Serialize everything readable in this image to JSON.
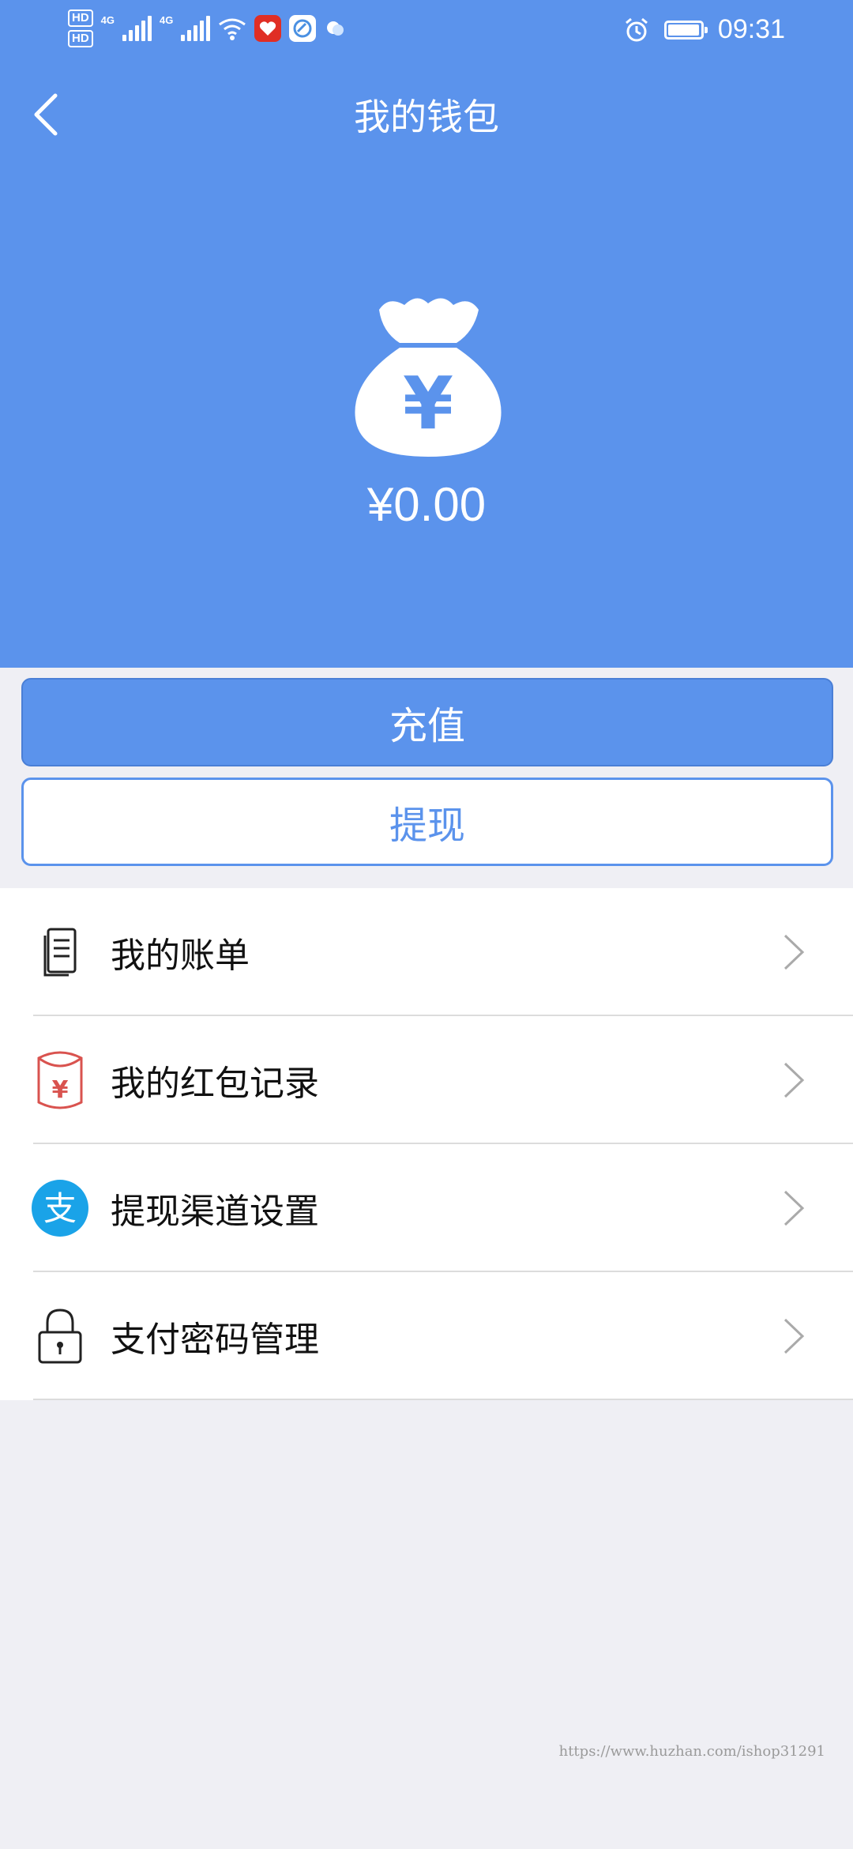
{
  "status_bar": {
    "hd_1": "HD",
    "hd_2": "HD",
    "net_1": "4G",
    "net_2": "4G",
    "time": "09:31",
    "icons": [
      "signal-icon",
      "wifi-icon",
      "alarm-icon",
      "battery-icon"
    ]
  },
  "header": {
    "title": "我的钱包",
    "back_icon": "chevron-left-icon"
  },
  "wallet": {
    "balance": "¥0.00",
    "icon": "money-bag-icon",
    "bag_symbol": "¥"
  },
  "actions": {
    "recharge_label": "充值",
    "withdraw_label": "提现"
  },
  "menu": {
    "items": [
      {
        "label": "我的账单",
        "icon": "bill-icon"
      },
      {
        "label": "我的红包记录",
        "icon": "red-envelope-icon",
        "icon_text": "¥"
      },
      {
        "label": "提现渠道设置",
        "icon": "alipay-icon",
        "icon_text": "支"
      },
      {
        "label": "支付密码管理",
        "icon": "lock-icon"
      }
    ]
  },
  "watermark": "https://www.huzhan.com/ishop31291",
  "colors": {
    "primary": "#5b93ec",
    "background": "#efeff4",
    "red_envelope": "#d9534f",
    "alipay": "#1aa3e8"
  }
}
